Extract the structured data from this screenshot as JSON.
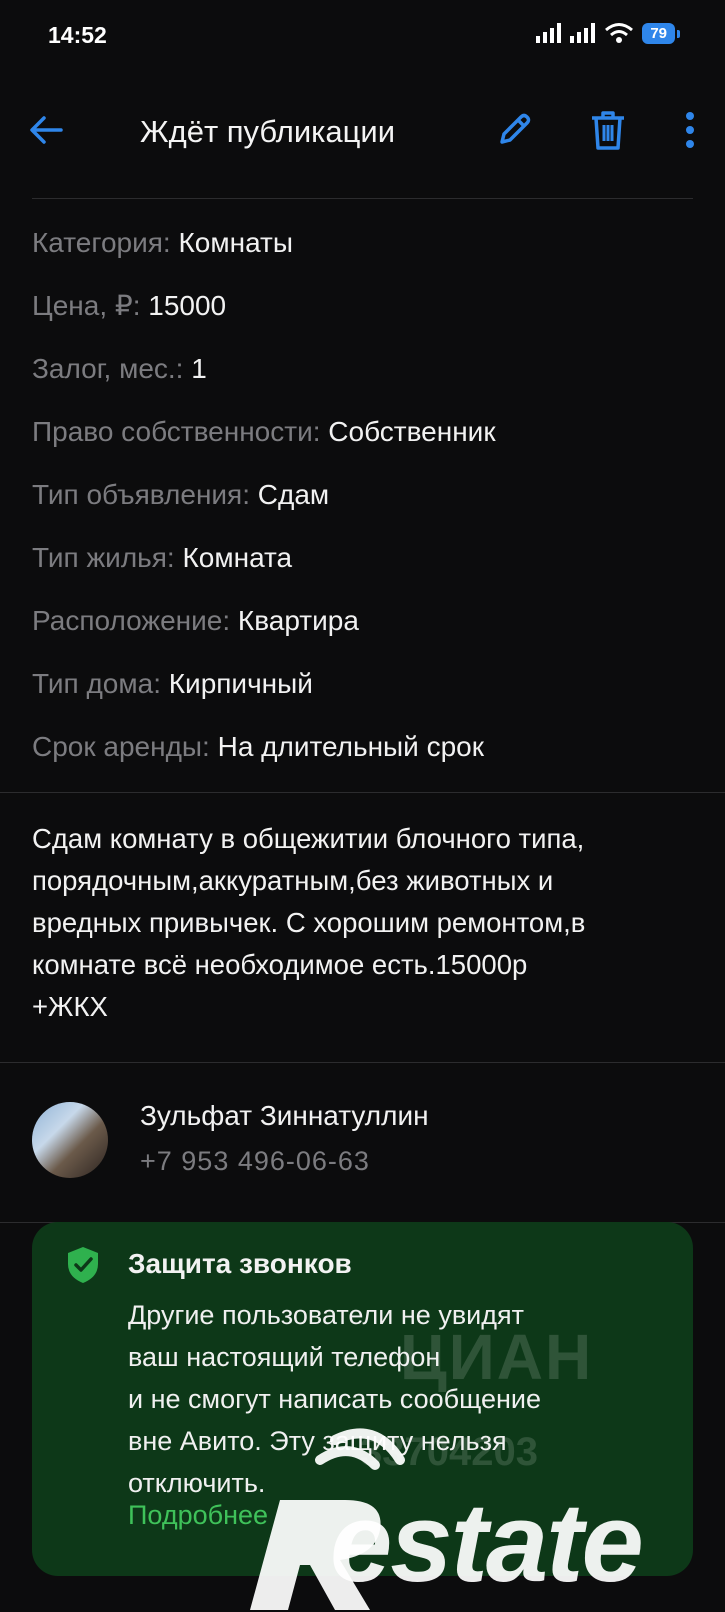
{
  "status_bar": {
    "time": "14:52",
    "battery": "79"
  },
  "header": {
    "title": "Ждёт публикации"
  },
  "details": [
    {
      "label": "Категория:",
      "value": "Комнаты"
    },
    {
      "label": "Цена, ₽:",
      "value": "15000"
    },
    {
      "label": "Залог, мес.:",
      "value": "1"
    },
    {
      "label": "Право собственности:",
      "value": "Собственник"
    },
    {
      "label": "Тип объявления:",
      "value": "Сдам"
    },
    {
      "label": "Тип жилья:",
      "value": "Комната"
    },
    {
      "label": "Расположение:",
      "value": "Квартира"
    },
    {
      "label": "Тип дома:",
      "value": "Кирпичный"
    },
    {
      "label": "Срок аренды:",
      "value": "На длительный срок"
    }
  ],
  "description": [
    "Сдам комнату в общежитии блочного типа,",
    "порядочным,аккуратным,без животных и",
    "вредных привычек.  С хорошим ремонтом,в",
    "комнате всё необходимое есть.15000р",
    "+ЖКХ"
  ],
  "contact": {
    "name": "Зульфат Зиннатуллин",
    "phone": "+7 953 496-06-63"
  },
  "call_protection": {
    "title": "Защита звонков",
    "body": [
      "Другие пользователи не увидят",
      "ваш настоящий телефон",
      "и не смогут написать сообщение",
      "вне Авито. Эту защиту нельзя",
      "отключить."
    ],
    "link": "Подробнее"
  },
  "watermark": {
    "cian": "ЦИАН",
    "id": "33704203",
    "logo": "estate"
  },
  "colors": {
    "accent": "#2f86ea",
    "card": "#0d3818",
    "link_green": "#3fc25a",
    "label_gray": "#7c7c80"
  }
}
